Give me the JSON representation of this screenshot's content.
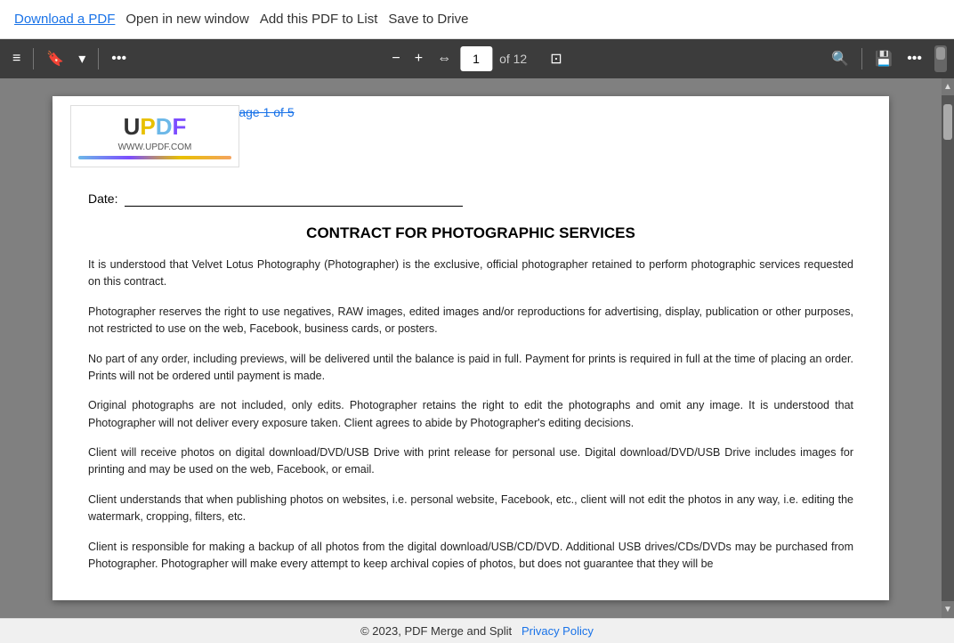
{
  "topbar": {
    "download_label": "Download a PDF",
    "open_label": "Open in new window",
    "add_label": "Add this PDF to List",
    "save_label": "Save to Drive"
  },
  "toolbar": {
    "page_current": "1",
    "page_of": "of 12",
    "zoom_icon": "⟳"
  },
  "pdf": {
    "watermark_url": "WWW.UPDF.COM",
    "page_title": "Page 1 of 5",
    "date_label": "Date:",
    "heading": "CONTRACT FOR PHOTOGRAPHIC SERVICES",
    "paragraphs": [
      "It is understood that Velvet Lotus Photography (Photographer) is the exclusive, official photographer retained to perform photographic services requested on this contract.",
      "Photographer reserves the right to use negatives, RAW images, edited images and/or reproductions for advertising, display, publication or other purposes, not restricted to use on the web, Facebook, business cards, or posters.",
      "No part of any order, including previews, will be delivered until the balance is paid in full. Payment for prints is required in full at the time of placing an order. Prints will not be ordered until payment is made.",
      "Original photographs are not included, only edits. Photographer retains the right to edit the photographs and omit any image. It is understood that Photographer will not deliver every exposure taken. Client agrees to abide by Photographer's editing decisions.",
      "Client will receive photos on digital download/DVD/USB Drive with print release for personal use. Digital download/DVD/USB Drive includes images for printing and may be used on the web, Facebook, or email.",
      "Client understands that when publishing photos on websites, i.e. personal website, Facebook, etc., client will not edit the photos in any way, i.e. editing the watermark, cropping, filters, etc.",
      "Client is responsible for making a backup of all photos from the digital download/USB/CD/DVD. Additional USB drives/CDs/DVDs may be purchased from Photographer. Photographer will make every attempt to keep archival copies of photos, but does not guarantee that they will be"
    ]
  },
  "footer": {
    "copyright": "© 2023, PDF Merge and Split",
    "privacy_label": "Privacy Policy"
  },
  "icons": {
    "list_icon": "≡",
    "bookmark_icon": "🔖",
    "chevron_down": "▾",
    "more_horiz": "•••",
    "minus": "−",
    "plus": "+",
    "swap": "⇔",
    "search": "🔍",
    "save": "💾",
    "rotate": "↻",
    "fit": "⊡"
  }
}
